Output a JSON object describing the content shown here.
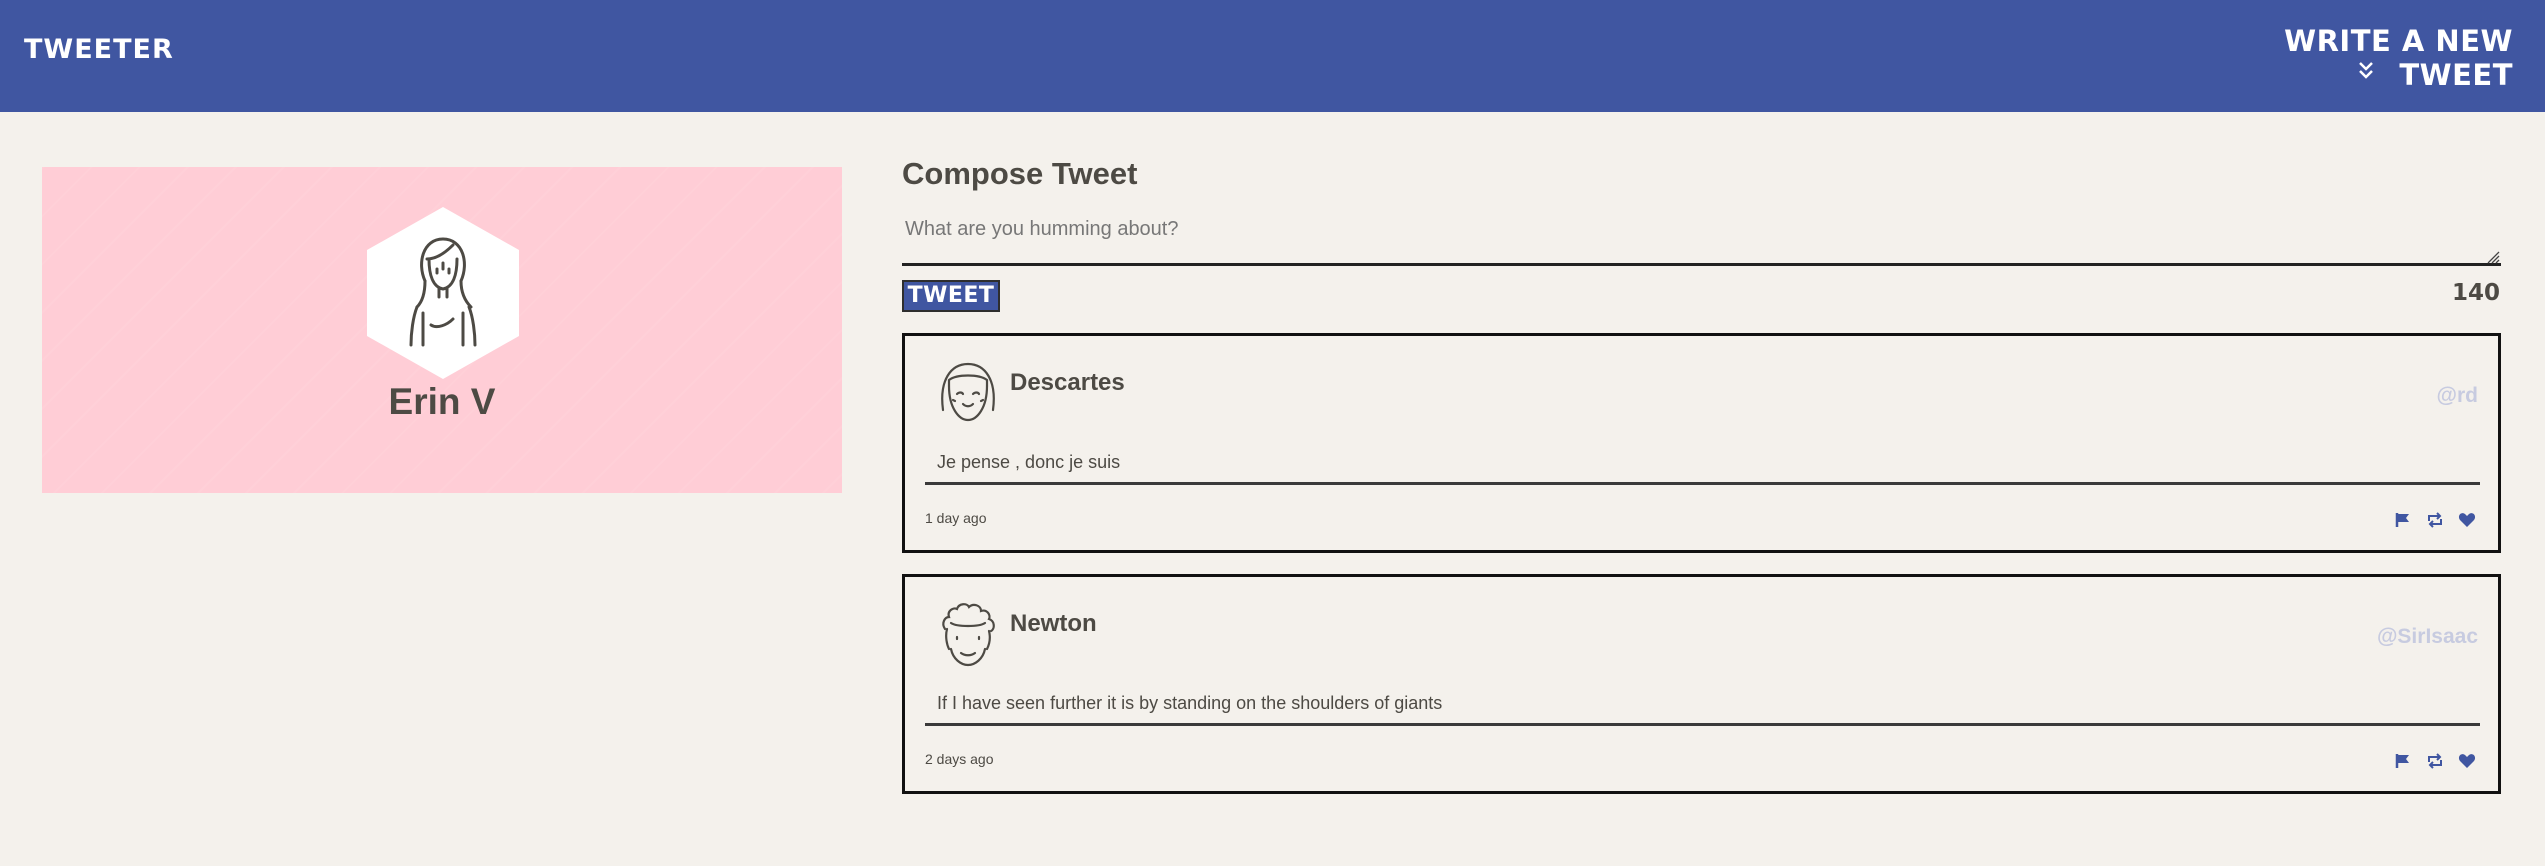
{
  "header": {
    "brand": "Tweeter",
    "write_label": "Write a new tweet",
    "chevron_icon": "double-chevron-down-icon"
  },
  "profile": {
    "name": "Erin V",
    "avatar_icon": "woman-avatar-icon",
    "background": "#ffcdd6"
  },
  "compose": {
    "title": "Compose Tweet",
    "placeholder": "What are you humming about?",
    "value": "",
    "button_label": "Tweet",
    "counter": "140"
  },
  "tweets": [
    {
      "author": "Descartes",
      "handle": "@rd",
      "text": "Je pense , donc je suis",
      "time": "1 day ago",
      "avatar_icon": "girl-avatar-icon"
    },
    {
      "author": "Newton",
      "handle": "@SirIsaac",
      "text": "If I have seen further it is by standing on the shoulders of giants",
      "time": "2 days ago",
      "avatar_icon": "curly-hair-avatar-icon"
    }
  ],
  "actions": [
    "flag-icon",
    "retweet-icon",
    "heart-icon"
  ],
  "colors": {
    "accent": "#4056a1",
    "background": "#f4f1ec",
    "text": "#4d4a44",
    "handle": "#c7cbe0"
  }
}
